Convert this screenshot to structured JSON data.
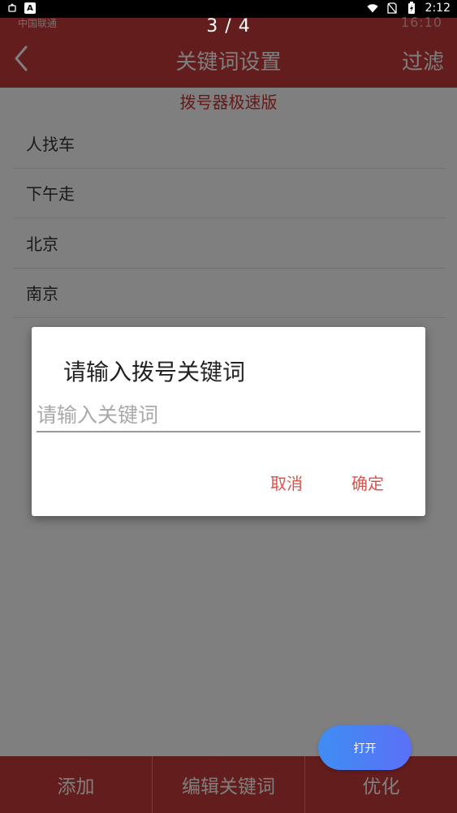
{
  "status_bar": {
    "time": "2:12",
    "carrier": "中国联通",
    "faint_status": "16:10"
  },
  "header": {
    "title": "关键词设置",
    "filter_label": "过滤",
    "pager": "3 / 4"
  },
  "subtitle": "拨号器极速版",
  "keywords": [
    {
      "label": "人找车"
    },
    {
      "label": "下午走"
    },
    {
      "label": "北京"
    },
    {
      "label": "南京"
    }
  ],
  "bottom_tabs": [
    {
      "label": "添加"
    },
    {
      "label": "编辑关键词"
    },
    {
      "label": "优化"
    }
  ],
  "fab": {
    "label": "打开"
  },
  "dialog": {
    "title": "请输入拨号关键词",
    "input_value": "",
    "input_placeholder": "请输入关键词",
    "cancel_label": "取消",
    "ok_label": "确定"
  },
  "colors": {
    "brand_red": "#c83a3a",
    "dialog_button": "#d9534f",
    "fab_start": "#3f8df3",
    "fab_end": "#5b70f7"
  },
  "icons": [
    "notification-icon",
    "a-badge-icon",
    "wifi-icon",
    "no-sim-icon",
    "battery-charging-icon",
    "back-chevron-icon"
  ]
}
